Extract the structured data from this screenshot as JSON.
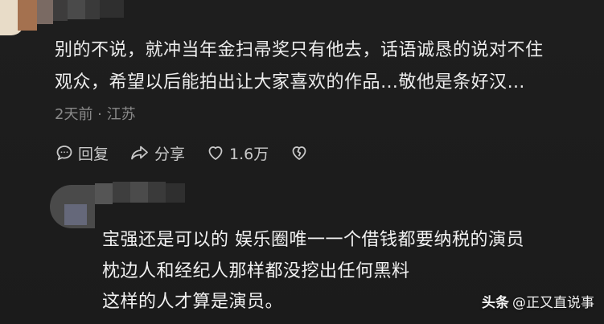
{
  "comment": {
    "lines": [
      "别的不说，就冲当年金扫帚奖只有他去，话语诚恳的说对不住",
      "观众，希望以后能拍出让大家喜欢的作品…敬他是条好汉…"
    ],
    "meta": "2天前 · 江苏",
    "actions": {
      "reply_label": "回复",
      "share_label": "分享",
      "like_count": "1.6万"
    }
  },
  "reply": {
    "lines": [
      "宝强还是可以的 娱乐圈唯一一个借钱都要纳税的演员",
      "枕边人和经纪人那样都没挖出任何黑料",
      "这样的人才算是演员。"
    ]
  },
  "watermark": {
    "brand": "头条",
    "handle": "@正又直说事"
  },
  "icons": {
    "reply": "comment-bubble-icon",
    "share": "share-arrow-icon",
    "like": "heart-icon",
    "dislike": "broken-heart-icon"
  },
  "colors": {
    "background": "#1c1c1c",
    "text": "#ededed",
    "meta": "#8a8a8a",
    "action": "#c9c9c9"
  }
}
